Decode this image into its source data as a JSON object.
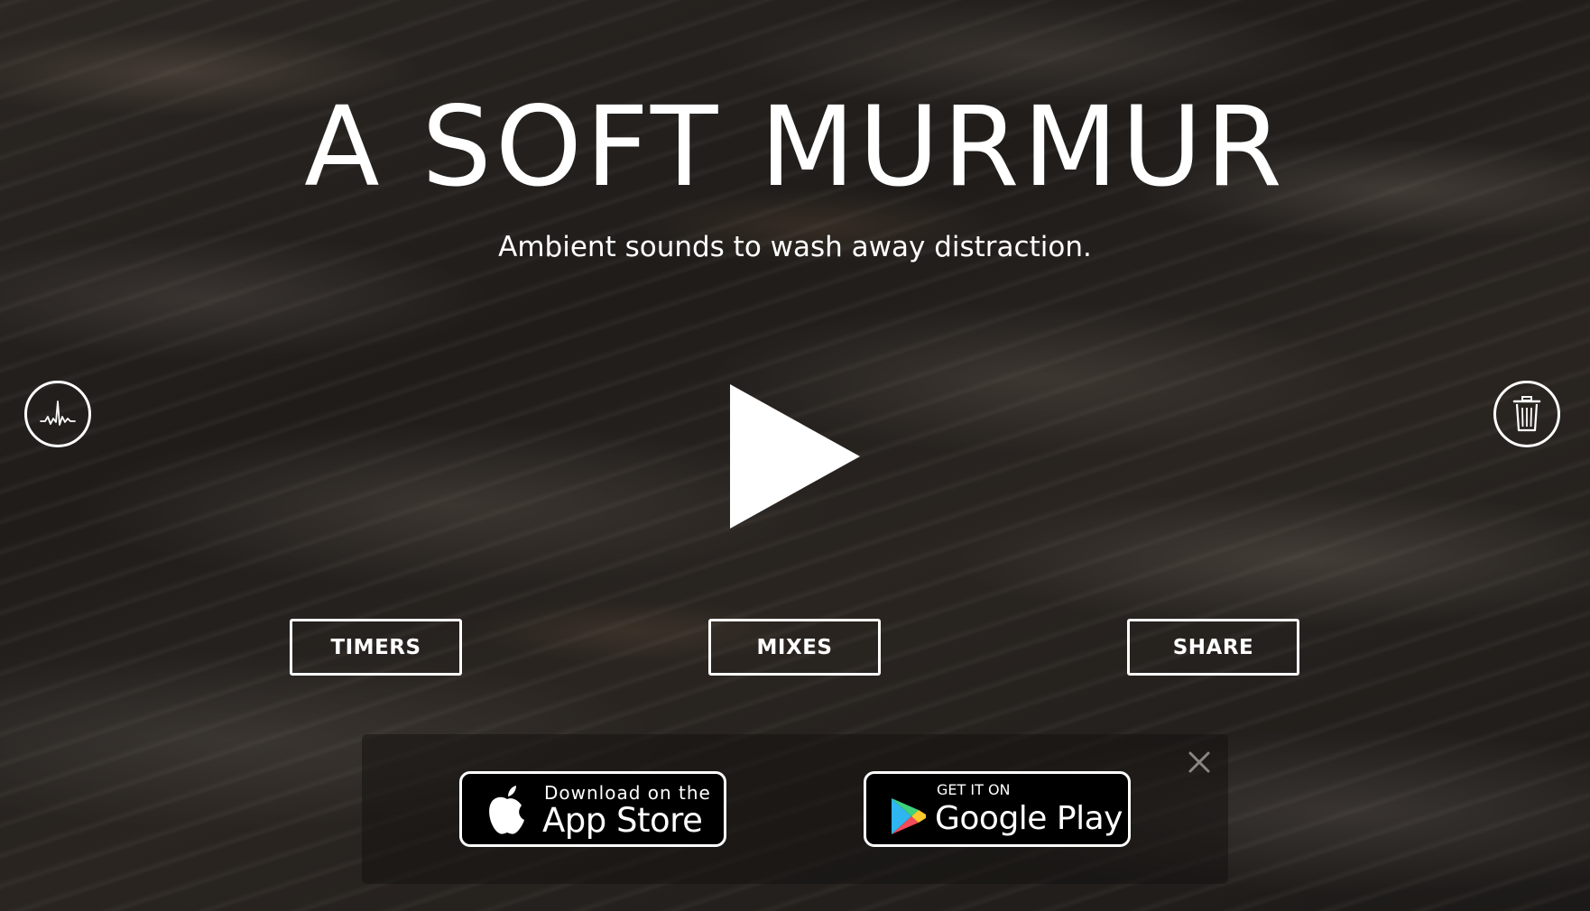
{
  "app": {
    "title": "A SOFT MURMUR",
    "subtitle": "Ambient sounds to wash away distraction."
  },
  "controls": {
    "left_icon": "waveform-icon",
    "right_icon": "trash-icon",
    "play_icon": "play-icon"
  },
  "nav": {
    "timers_label": "TIMERS",
    "mixes_label": "MIXES",
    "share_label": "SHARE"
  },
  "app_banner": {
    "close_icon": "close-icon",
    "apple": {
      "small_text": "Download on the",
      "big_text": "App Store",
      "icon": "apple-icon"
    },
    "google": {
      "small_text": "GET IT ON",
      "big_text": "Google Play",
      "icon": "google-play-icon"
    }
  },
  "colors": {
    "foreground": "#ffffff",
    "badge_background": "#000000",
    "banner_background": "rgba(20,18,16,0.55)"
  }
}
